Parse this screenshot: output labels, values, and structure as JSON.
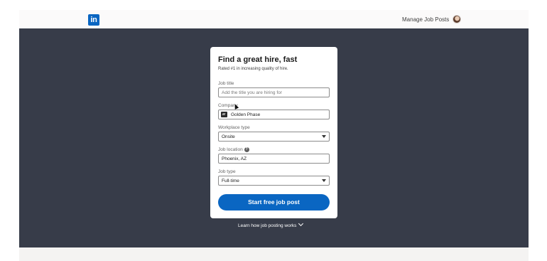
{
  "header": {
    "logo_text": "in",
    "manage_link": "Manage Job Posts",
    "brand_color": "#0a66c2"
  },
  "form": {
    "title": "Find a great hire, fast",
    "subtitle": "Rated #1 in increasing quality of hire.",
    "job_title": {
      "label": "Job title",
      "placeholder": "Add the title you are hiring for",
      "value": ""
    },
    "company": {
      "label": "Company",
      "value": "Golden Phase"
    },
    "workplace_type": {
      "label": "Workplace type",
      "value": "Onsite"
    },
    "job_location": {
      "label": "Job location",
      "value": "Phoenix, AZ",
      "help_icon": "?"
    },
    "job_type": {
      "label": "Job type",
      "value": "Full-time"
    },
    "submit_label": "Start free job post"
  },
  "learn_link": "Learn how job posting works",
  "colors": {
    "hero_background": "#373c49",
    "card_background": "#ffffff",
    "cta_background": "#0a66c2"
  }
}
